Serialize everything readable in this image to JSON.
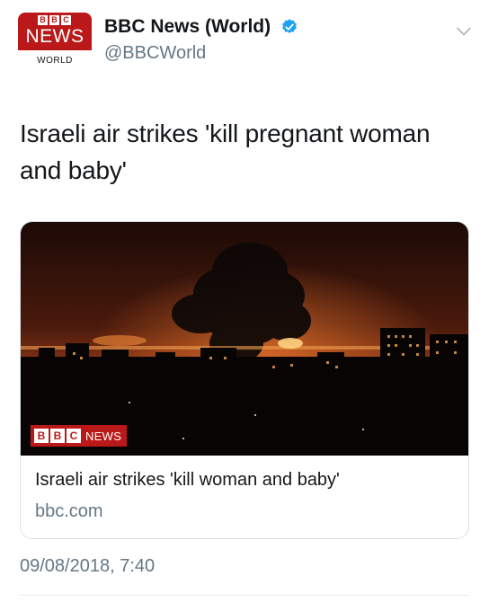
{
  "account": {
    "avatar_letters": [
      "B",
      "B",
      "C"
    ],
    "avatar_news": "NEWS",
    "avatar_world": "WORLD",
    "display_name": "BBC News (World)",
    "handle": "@BBCWorld",
    "verified": true
  },
  "tweet": {
    "text": "Israeli air strikes 'kill pregnant woman and baby'",
    "timestamp": "09/08/2018, 7:40"
  },
  "card": {
    "badge_letters": [
      "B",
      "B",
      "C"
    ],
    "badge_text": "NEWS",
    "title": "Israeli air strikes 'kill woman and baby'",
    "domain": "bbc.com"
  },
  "icons": {
    "verified": "verified-badge-icon",
    "menu": "chevron-down-icon"
  },
  "colors": {
    "bbc_red": "#bb1919",
    "verified_blue": "#1da1f2",
    "secondary_text": "#657786"
  }
}
